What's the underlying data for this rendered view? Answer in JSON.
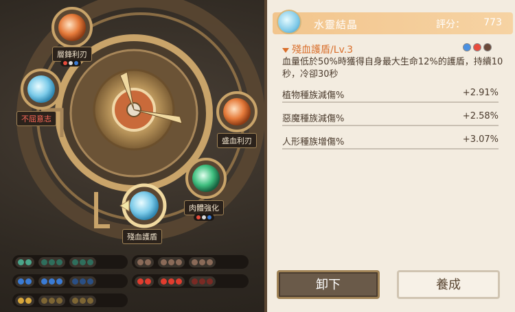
{
  "slots": [
    {
      "title": "層鋒利刃",
      "red": false
    },
    {
      "title": "不屈意志",
      "red": true
    },
    {
      "title": "盛血利刃",
      "red": false
    },
    {
      "title": "肉體強化",
      "red": false
    },
    {
      "title": "殘血護盾",
      "red": false
    }
  ],
  "slot_pips": [
    [
      "#e74c3c",
      "#d9d9d9",
      "#3a7bd5"
    ],
    [
      "#e74c3c",
      "#d9d9d9",
      "#3a7bd5"
    ],
    [
      "#e74c3c",
      "#d9d9d9",
      "#3a7bd5"
    ]
  ],
  "detail": {
    "gem_name": "水靈結晶",
    "score_label": "評分：",
    "score_value": "773",
    "skill_title": "殘血護盾/Lv.3",
    "skill_colors": [
      "#4a90e2",
      "#e84c3d",
      "#6b4a3a"
    ],
    "description": "血量低於50%時獲得自身最大生命12%的護盾，持續10秒，冷卻30秒",
    "stats": [
      {
        "label": "植物種族減傷%",
        "value": "+2.91%"
      },
      {
        "label": "惡魔種族減傷%",
        "value": "+2.58%"
      },
      {
        "label": "人形種族增傷%",
        "value": "+3.07%"
      }
    ]
  },
  "buttons": {
    "unequip": "卸下",
    "upgrade": "養成"
  },
  "colors": {
    "gold": "#c9a46a",
    "panel": "#f3ece0",
    "accent": "#d96e2a",
    "socket_green": "#4aa58a",
    "socket_blue": "#3a7bd5",
    "socket_yellow": "#d9a73a",
    "socket_red": "#e23c2e",
    "socket_brown": "#8a6a58"
  }
}
